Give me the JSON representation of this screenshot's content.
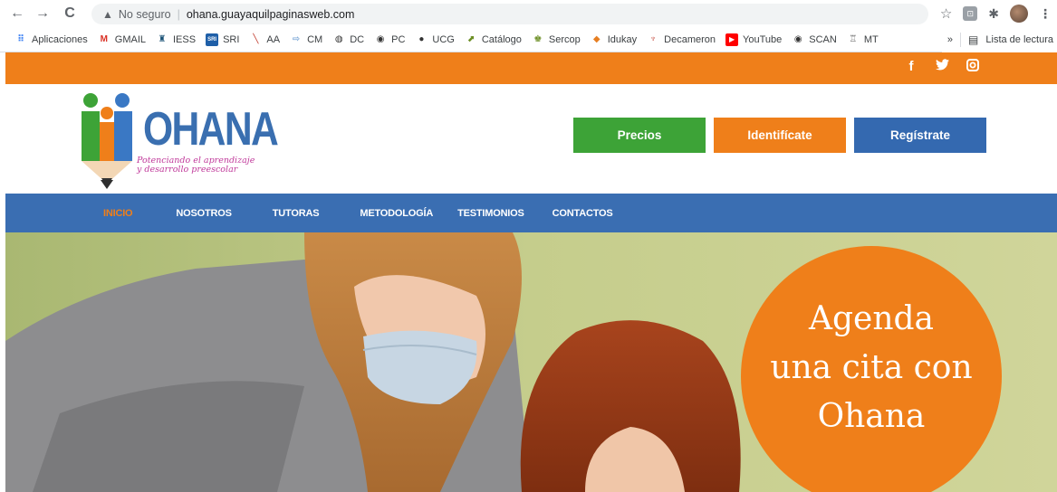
{
  "browser": {
    "security_label": "No seguro",
    "url": "ohana.guayaquilpaginasweb.com",
    "bookmarks": [
      {
        "label": "Aplicaciones",
        "icon": "apps-grid-icon"
      },
      {
        "label": "GMAIL",
        "icon": "gmail-icon"
      },
      {
        "label": "IESS",
        "icon": "iess-icon"
      },
      {
        "label": "SRI",
        "icon": "sri-icon"
      },
      {
        "label": "AA",
        "icon": "aa-icon"
      },
      {
        "label": "CM",
        "icon": "cm-icon"
      },
      {
        "label": "DC",
        "icon": "dc-icon"
      },
      {
        "label": "PC",
        "icon": "globe-icon"
      },
      {
        "label": "UCG",
        "icon": "ucg-icon"
      },
      {
        "label": "Catálogo",
        "icon": "catalogo-icon"
      },
      {
        "label": "Sercop",
        "icon": "sercop-icon"
      },
      {
        "label": "Idukay",
        "icon": "idukay-icon"
      },
      {
        "label": "Decameron",
        "icon": "decameron-icon"
      },
      {
        "label": "YouTube",
        "icon": "youtube-icon"
      },
      {
        "label": "SCAN",
        "icon": "globe-icon"
      },
      {
        "label": "MT",
        "icon": "mt-icon"
      }
    ],
    "more_bookmarks": "»",
    "reading_list": "Lista de lectura"
  },
  "site": {
    "logo_name": "OHANA",
    "logo_tagline_1": "Potenciando el aprendizaje",
    "logo_tagline_2": "y desarrollo preescolar",
    "buttons": {
      "precios": "Precios",
      "identificate": "Identifícate",
      "registrate": "Regístrate"
    },
    "menu": [
      "INICIO",
      "NOSOTROS",
      "TUTORAS",
      "METODOLOGÍA",
      "TESTIMONIOS",
      "CONTACTOS"
    ],
    "hero": {
      "line1": "Agenda",
      "line2": "una cita con",
      "line3": "Ohana"
    }
  },
  "colors": {
    "orange": "#ef7f1a",
    "green": "#3da337",
    "blue": "#3469b0",
    "menu_blue": "#3a6eb2"
  }
}
